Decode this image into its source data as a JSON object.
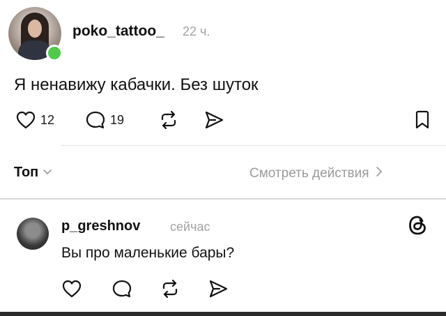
{
  "post": {
    "username": "poko_tattoo_",
    "time": "22 ч.",
    "text": "Я ненавижу кабачки. Без шуток",
    "likes": "12",
    "comments": "19",
    "online": true,
    "online_color": "#4fc94a"
  },
  "replies_header": {
    "sort_label": "Топ",
    "view_activity_label": "Смотреть действия"
  },
  "reply": {
    "username": "p_greshnov",
    "time": "сейчас",
    "text": "Вы про маленькие бары?"
  },
  "icons": [
    "heart-icon",
    "comment-icon",
    "repost-icon",
    "share-icon",
    "bookmark-icon",
    "chevron-down-icon",
    "chevron-right-icon",
    "threads-logo-icon"
  ]
}
